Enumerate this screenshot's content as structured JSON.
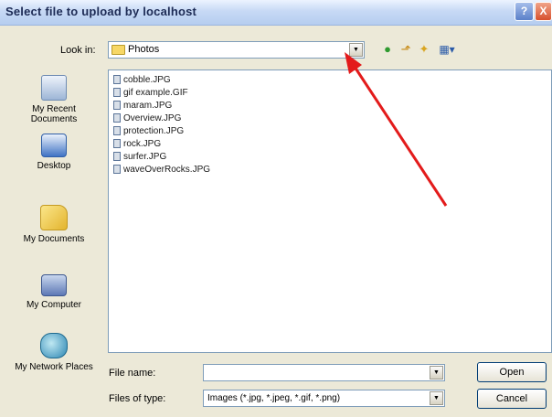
{
  "window": {
    "title": "Select file to upload by localhost",
    "help_glyph": "?",
    "close_glyph": "X"
  },
  "toolbar": {
    "lookin_label": "Look in:",
    "lookin_value": "Photos",
    "dropdown_glyph": "▼",
    "back_glyph": "●",
    "up_glyph": "⬏",
    "newfolder_glyph": "✦",
    "views_glyph": "▦▾"
  },
  "places": [
    {
      "label": "My Recent Documents",
      "icon": "recent-documents-icon"
    },
    {
      "label": "Desktop",
      "icon": "desktop-icon"
    },
    {
      "label": "My Documents",
      "icon": "my-documents-icon"
    },
    {
      "label": "My Computer",
      "icon": "my-computer-icon"
    },
    {
      "label": "My Network Places",
      "icon": "network-places-icon"
    }
  ],
  "files": [
    "cobble.JPG",
    "gif example.GIF",
    "maram.JPG",
    "Overview.JPG",
    "protection.JPG",
    "rock.JPG",
    "surfer.JPG",
    "waveOverRocks.JPG"
  ],
  "form": {
    "filename_label": "File name:",
    "filename_value": "",
    "filetype_label": "Files of type:",
    "filetype_value": "Images (*.jpg, *.jpeg, *.gif, *.png)"
  },
  "buttons": {
    "open": "Open",
    "cancel": "Cancel"
  },
  "colors": {
    "annotation_arrow": "#e31b1b",
    "folder": "#f7d765",
    "dialog_bg": "#ece9d8"
  }
}
